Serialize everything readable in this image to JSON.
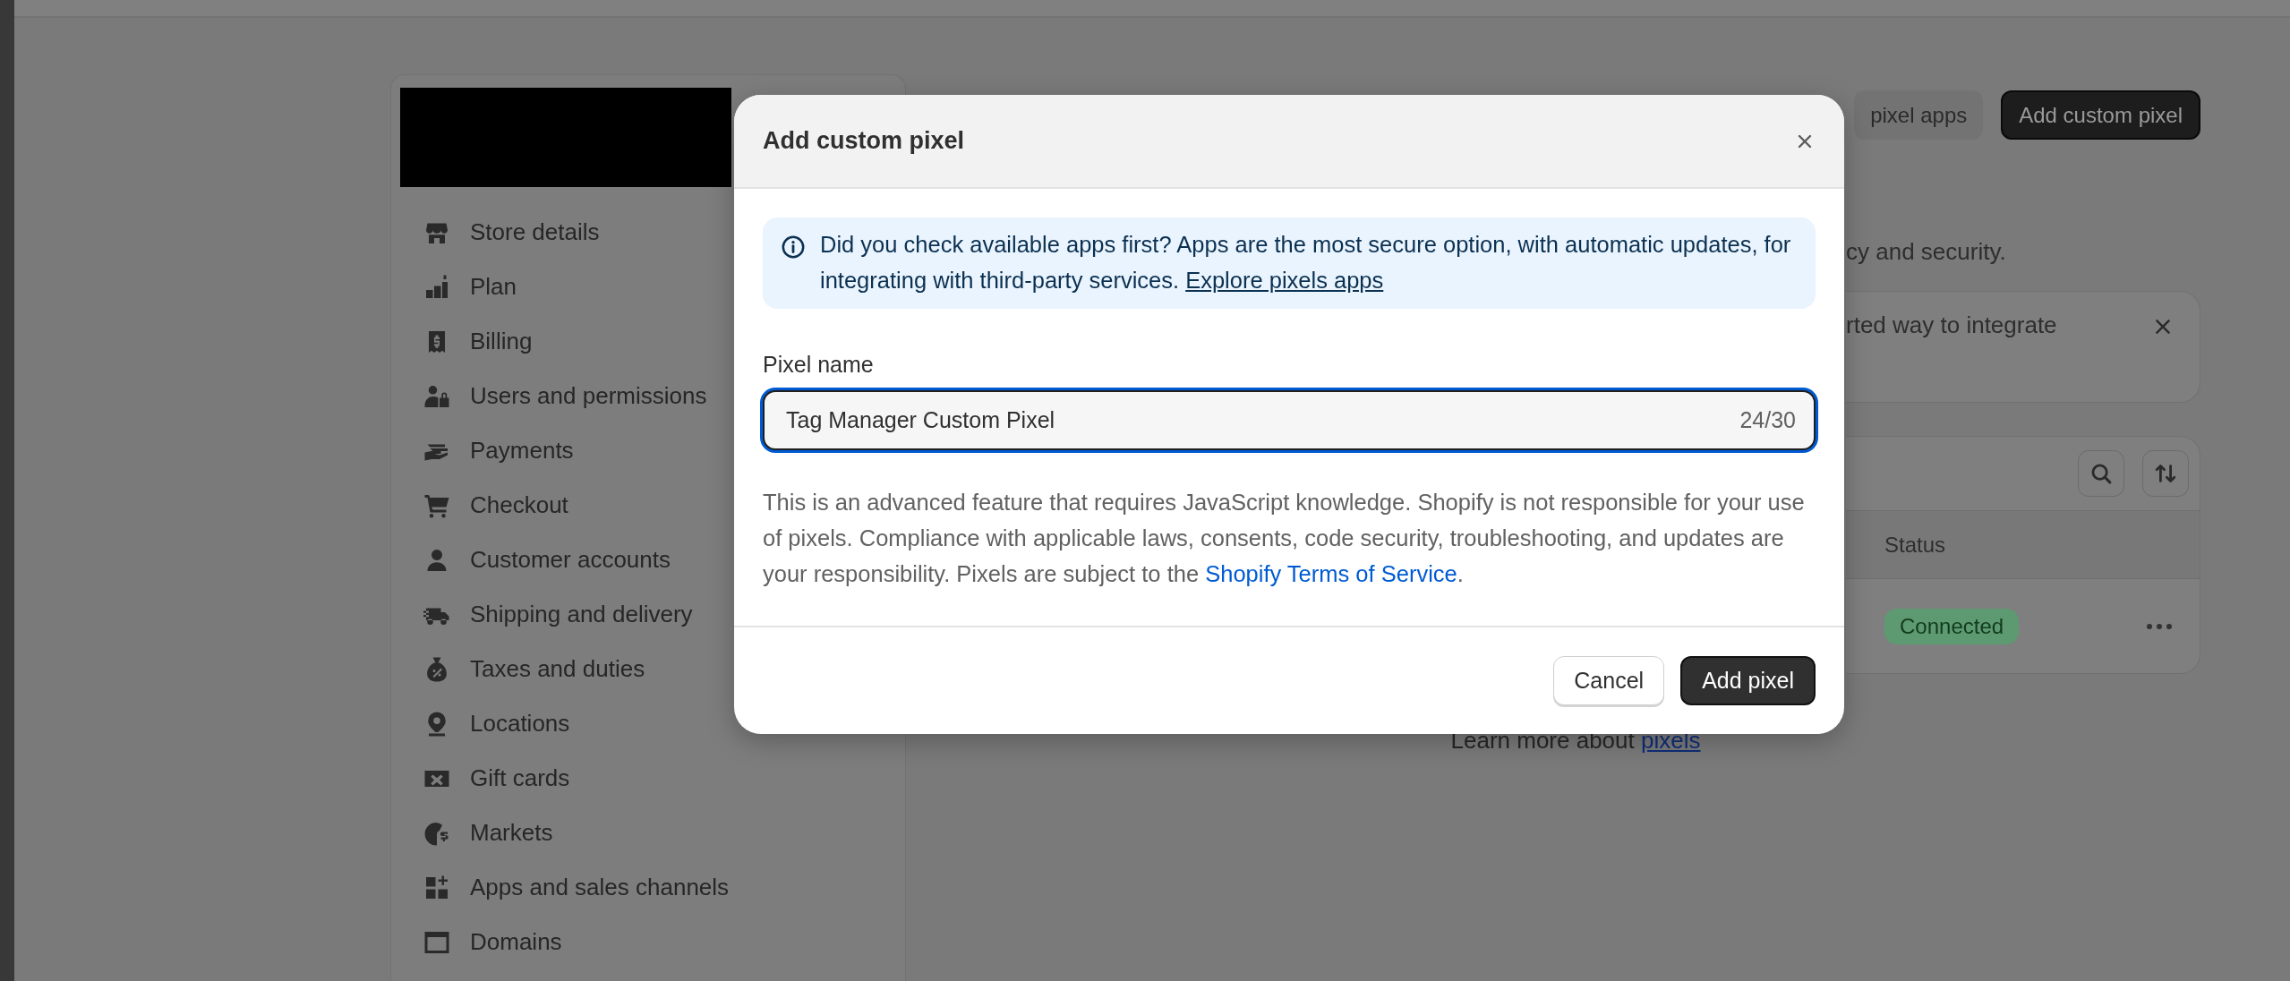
{
  "sidebar": {
    "items": [
      "Store details",
      "Plan",
      "Billing",
      "Users and permissions",
      "Payments",
      "Checkout",
      "Customer accounts",
      "Shipping and delivery",
      "Taxes and duties",
      "Locations",
      "Gift cards",
      "Markets",
      "Apps and sales channels",
      "Domains"
    ]
  },
  "page": {
    "header_buttons": [
      {
        "label": "pixel apps",
        "kind": "secondary"
      },
      {
        "label": "Add custom pixel",
        "kind": "primary"
      }
    ],
    "description": "cy and security.",
    "banner": {
      "text": "rted way to integrate"
    },
    "table": {
      "columns": [
        "Status"
      ],
      "rows": [
        {
          "status": "Connected"
        }
      ]
    },
    "footer": {
      "text": "Learn more about ",
      "link": "pixels"
    }
  },
  "modal": {
    "title": "Add custom pixel",
    "notice": {
      "text": "Did you check available apps first? Apps are the most secure option, with automatic updates, for integrating with third-party services. ",
      "link": "Explore pixels apps"
    },
    "field": {
      "label": "Pixel name",
      "value": "Tag Manager Custom Pixel",
      "counter": "24/30"
    },
    "disclaimer": {
      "text": "This is an advanced feature that requires JavaScript knowledge. Shopify is not responsible for your use of pixels. Compliance with applicable laws, consents, code security, troubleshooting, and updates are your responsibility. Pixels are subject to the ",
      "link": "Shopify Terms of Service",
      "end": "."
    },
    "buttons": [
      {
        "label": "Cancel",
        "kind": "secondary"
      },
      {
        "label": "Add pixel",
        "kind": "primary"
      }
    ]
  }
}
